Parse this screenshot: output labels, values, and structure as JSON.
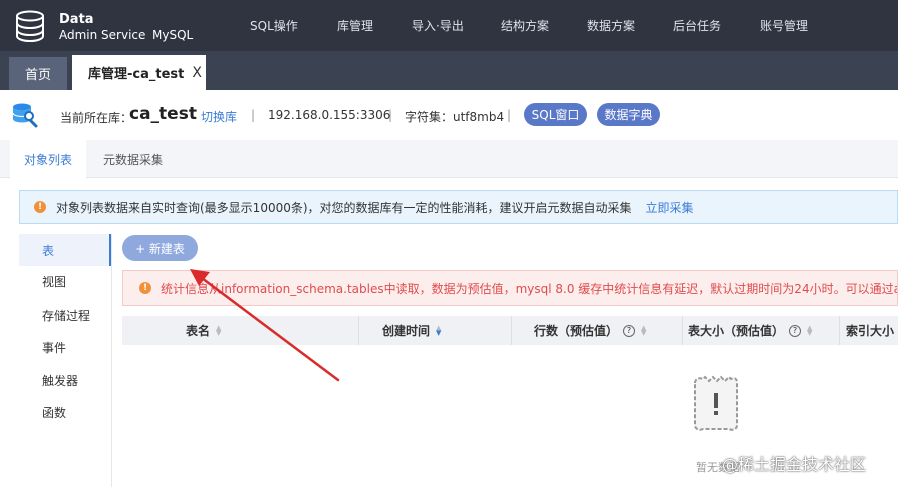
{
  "app": {
    "brand_line1": "Data",
    "brand_line2": "Admin Service",
    "brand_line3": "MySQL"
  },
  "nav": [
    "SQL操作",
    "库管理",
    "导入·导出",
    "结构方案",
    "数据方案",
    "后台任务",
    "账号管理"
  ],
  "tabs": {
    "home": "首页",
    "active": "库管理-ca_test",
    "close": "X"
  },
  "db": {
    "label": "当前所在库：",
    "name": "ca_test",
    "switch": "切换库",
    "separator": "|",
    "host": "192.168.0.155:3306",
    "charset": "字符集：utf8mb4",
    "sql_btn": "SQL窗口",
    "dict_btn": "数据字典"
  },
  "subtabs": {
    "objects": "对象列表",
    "meta": "元数据采集"
  },
  "notice1": {
    "text": "对象列表数据来自实时查询(最多显示10000条)，对您的数据库有一定的性能消耗，建议开启元数据自动采集",
    "link": "立即采集"
  },
  "leftmenu": [
    "表",
    "视图",
    "存储过程",
    "事件",
    "触发器",
    "函数"
  ],
  "new_table": "+ 新建表",
  "notice2": {
    "text": "统计信息从information_schema.tables中读取，数据为预估值，mysql 8.0 缓存中统计信息有延迟，默认过期时间为24小时。可以通过analyze ta"
  },
  "table": {
    "columns": [
      "表名",
      "创建时间",
      "行数（预估值）",
      "表大小（预估值）",
      "索引大小"
    ],
    "empty": "暂无数据"
  },
  "watermark": "@稀土掘金技术社区",
  "colors": {
    "topbar": "#2f3440",
    "accent": "#3a7bd5",
    "pill": "#5a78c8",
    "warn": "#f0913a",
    "error": "#e04b4b",
    "arrow": "#d92b2b"
  }
}
